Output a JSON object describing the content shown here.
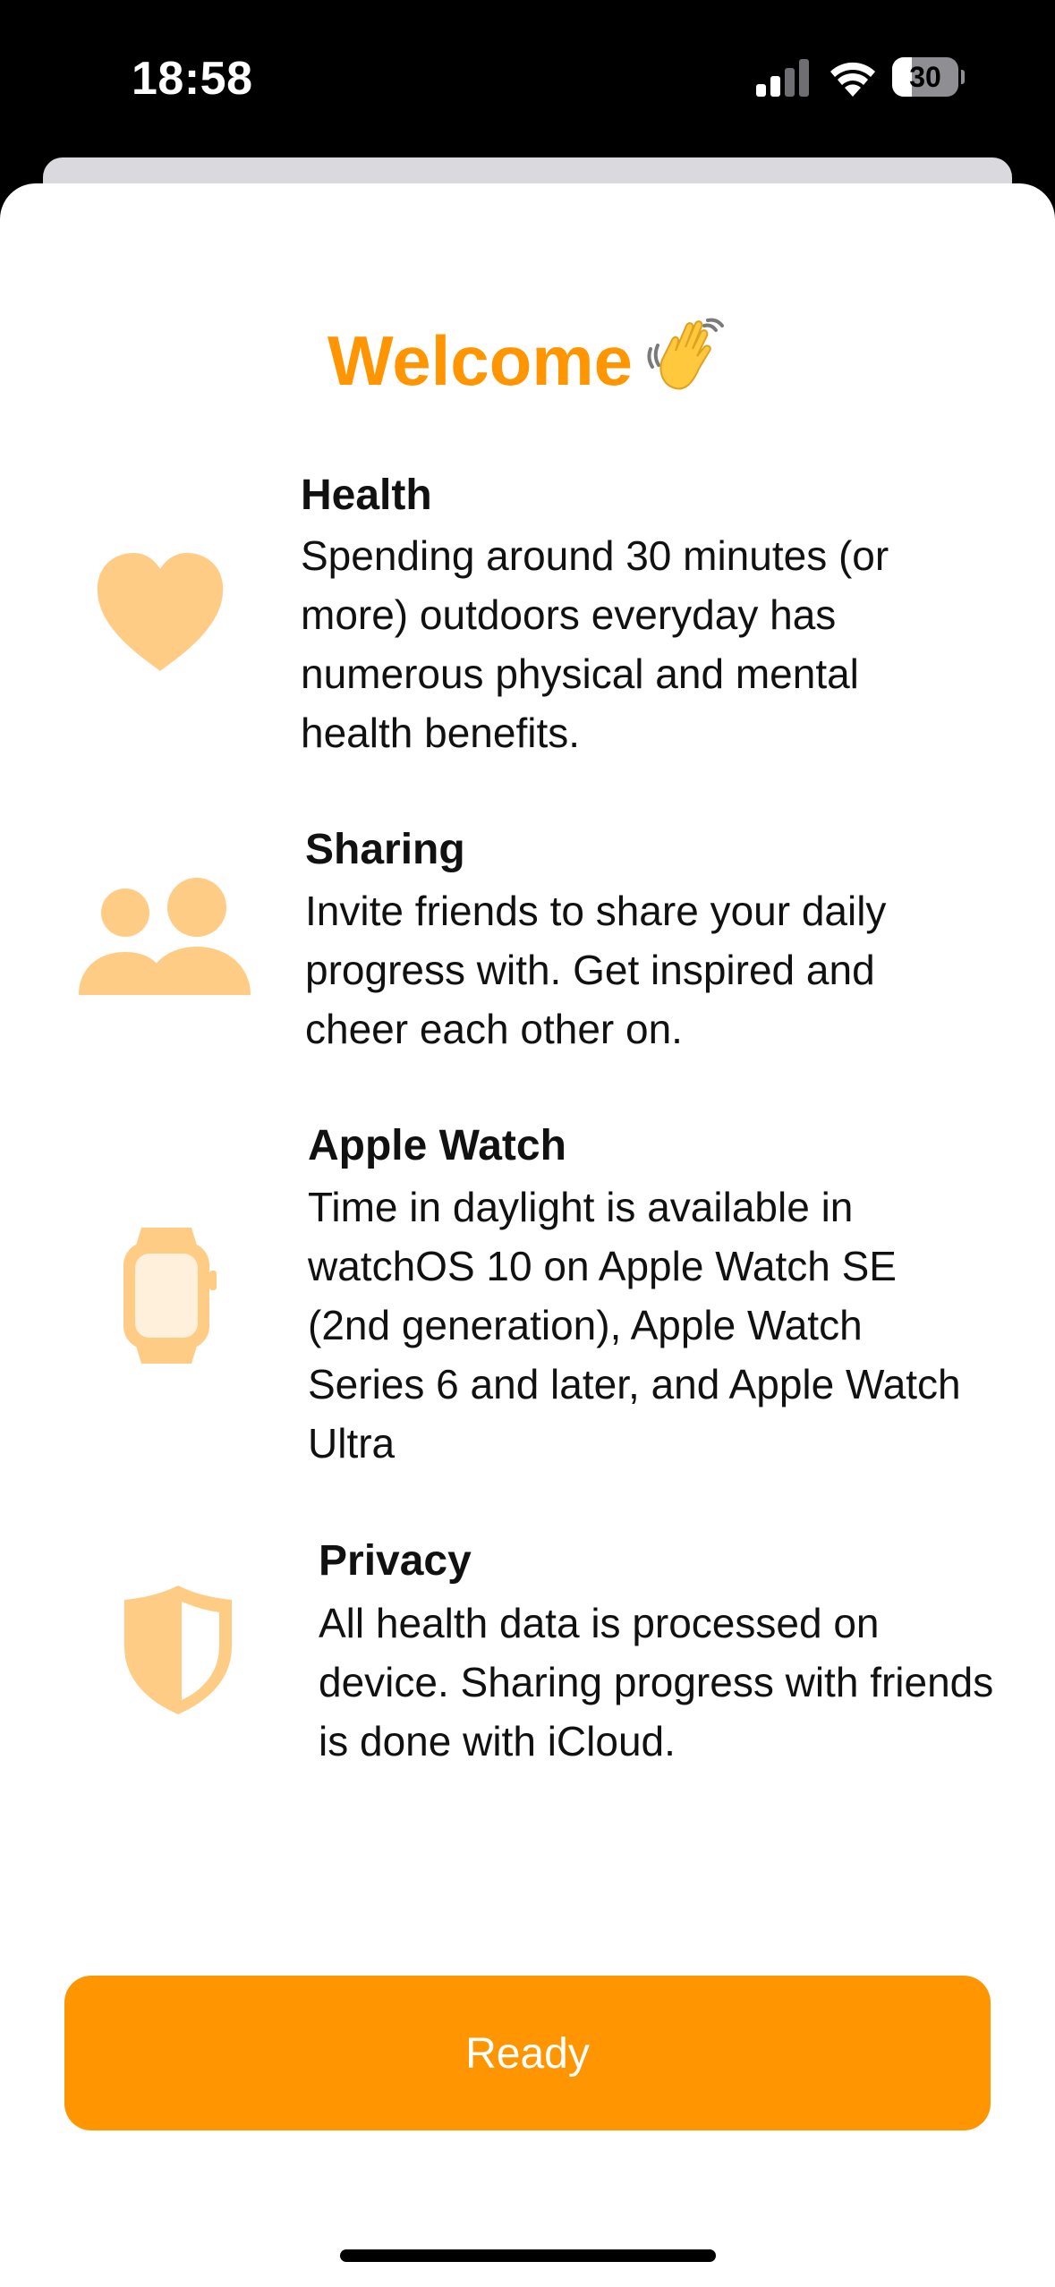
{
  "status_bar": {
    "time": "18:58",
    "battery_level": "30",
    "battery_fraction": 0.3,
    "icons": [
      "cellular-signal-icon",
      "wifi-icon",
      "battery-icon"
    ]
  },
  "welcome": {
    "title": "Welcome",
    "emoji": "waving-hand-icon"
  },
  "features": [
    {
      "icon": "heart-icon",
      "title": "Health",
      "description": "Spending around 30 minutes (or more) outdoors everyday has numerous physical and mental health benefits."
    },
    {
      "icon": "people-icon",
      "title": "Sharing",
      "description": "Invite friends to share your daily progress with. Get inspired and cheer each other on."
    },
    {
      "icon": "apple-watch-icon",
      "title": "Apple Watch",
      "description": "Time in daylight is available in watchOS 10 on Apple Watch SE (2nd generation), Apple Watch Series 6 and later, and Apple Watch Ultra"
    },
    {
      "icon": "shield-icon",
      "title": "Privacy",
      "description": "All health data is processed on device. Sharing progress with friends is done with iCloud."
    }
  ],
  "ready_button": {
    "label": "Ready"
  },
  "colors": {
    "accent": "#ff9500",
    "icon_tint": "#ffcc85",
    "text": "#111111",
    "background": "#ffffff"
  }
}
